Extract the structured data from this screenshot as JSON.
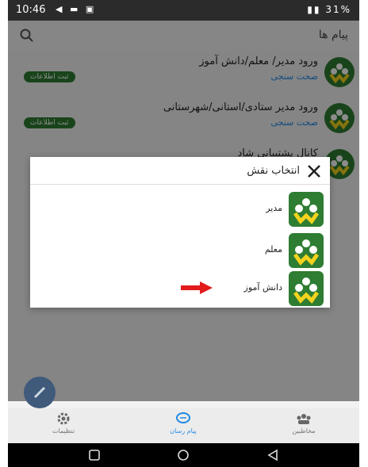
{
  "status_bar": {
    "time": "10:46",
    "battery": "31%"
  },
  "app_bar": {
    "title": "پیام ها"
  },
  "list": [
    {
      "title": "ورود مدیر/ معلم/دانش آموز",
      "subtitle": "صحت سنجی",
      "badge": "ثبت اطلاعات"
    },
    {
      "title": "ورود مدیر ستادی/استانی/شهرستانی",
      "subtitle": "صحت سنجی",
      "badge": "ثبت اطلاعات"
    },
    {
      "title": "کانال پشتیبانی شاد",
      "subtitle": "",
      "badge": ""
    }
  ],
  "dialog": {
    "title": "انتخاب نقش",
    "options": [
      {
        "label": "مدیر"
      },
      {
        "label": "معلم"
      },
      {
        "label": "دانش آموز"
      }
    ]
  },
  "bottom_nav": [
    {
      "label": "تنظیمات",
      "icon": "gear-icon"
    },
    {
      "label": "پیام رسان",
      "icon": "chat-icon"
    },
    {
      "label": "مخاطبین",
      "icon": "contacts-icon"
    }
  ],
  "colors": {
    "brand_green": "#2e7d32",
    "badge_green": "#2e7d32",
    "accent_blue": "#1e88e5",
    "arrow_red": "#e21b1b",
    "logo_yellow": "#f4d21d"
  }
}
